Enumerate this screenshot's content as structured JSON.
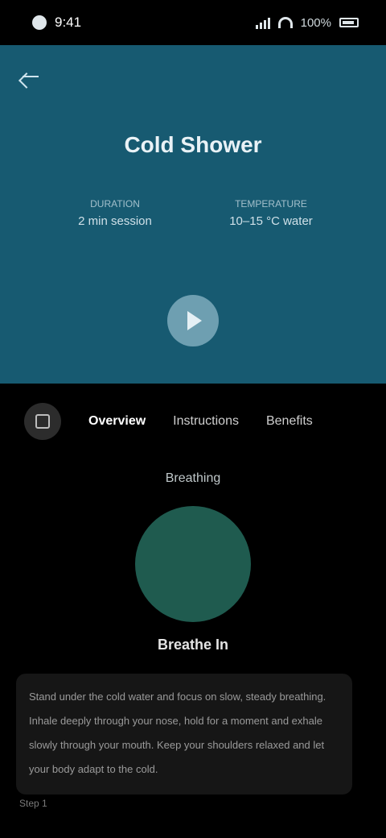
{
  "status_bar": {
    "time": "9:41",
    "battery": "100%"
  },
  "hero": {
    "title": "Cold Shower",
    "stats": [
      {
        "label": "DURATION",
        "value": "2 min session"
      },
      {
        "label": "TEMPERATURE",
        "value": "10–15 °C water"
      }
    ],
    "bg_color": "#175a71"
  },
  "tabs": [
    {
      "label": "Overview",
      "active": true
    },
    {
      "label": "Instructions",
      "active": false
    },
    {
      "label": "Benefits",
      "active": false
    }
  ],
  "section": {
    "title": "Breathing",
    "circle_label": "Breathe In",
    "circle_color": "#1f5b4f",
    "description": "Stand under the cold water and focus on slow, steady breathing. Inhale deeply through your nose, hold for a moment and exhale slowly through your mouth. Keep your shoulders relaxed and let your body adapt to the cold.",
    "footer": "Step 1"
  }
}
